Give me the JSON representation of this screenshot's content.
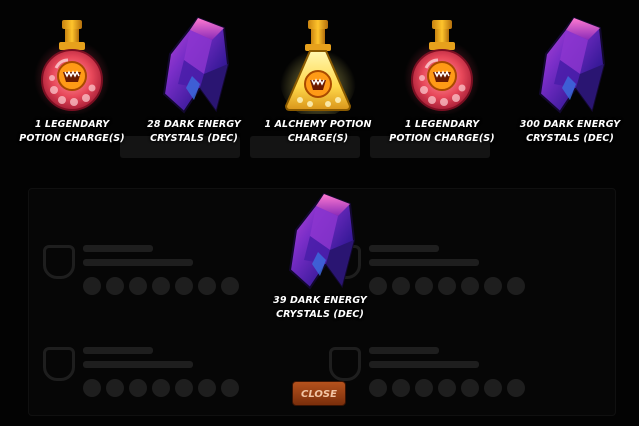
{
  "rewards": [
    {
      "type": "legendary-potion",
      "label_line1": "1 LEGENDARY",
      "label_line2": "POTION CHARGE(S)"
    },
    {
      "type": "dark-energy-crystal",
      "label_line1": "28 DARK ENERGY",
      "label_line2": "CRYSTALS (DEC)"
    },
    {
      "type": "alchemy-potion",
      "label_line1": "1 ALCHEMY POTION",
      "label_line2": "CHARGE(S)"
    },
    {
      "type": "legendary-potion",
      "label_line1": "1 LEGENDARY",
      "label_line2": "POTION CHARGE(S)"
    },
    {
      "type": "dark-energy-crystal",
      "label_line1": "300 DARK ENERGY",
      "label_line2": "CRYSTALS (DEC)"
    },
    {
      "type": "dark-energy-crystal",
      "label_line1": "39 DARK ENERGY",
      "label_line2": "CRYSTALS (DEC)"
    }
  ],
  "close_label": "CLOSE",
  "colors": {
    "overlay": "#030303",
    "label_text": "#ffffff",
    "close_button": "#9a4015",
    "close_text": "#f2c5a5",
    "legendary_potion": "#e8485a",
    "alchemy_potion": "#ffd84a",
    "crystal": "#6a2bb8"
  },
  "icons": {
    "legendary_potion": "legendary-potion-icon",
    "alchemy_potion": "alchemy-potion-icon",
    "crystal": "dark-energy-crystal-icon"
  }
}
